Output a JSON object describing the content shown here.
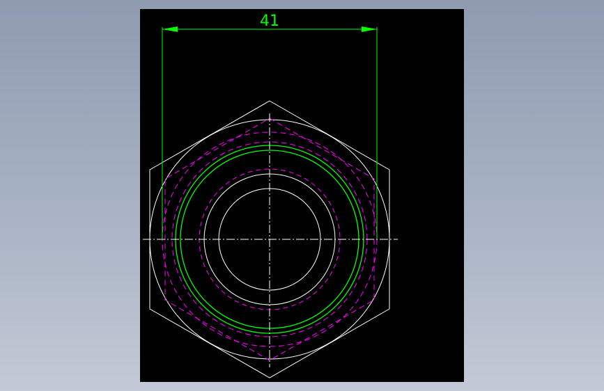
{
  "drawing": {
    "dimension_label": "41",
    "colors": {
      "background": "#000000",
      "outline": "#ffffff",
      "dimension": "#00ff00",
      "thread": "#00ff00",
      "hidden": "#ff00ff",
      "centerline": "#ffffff"
    }
  }
}
